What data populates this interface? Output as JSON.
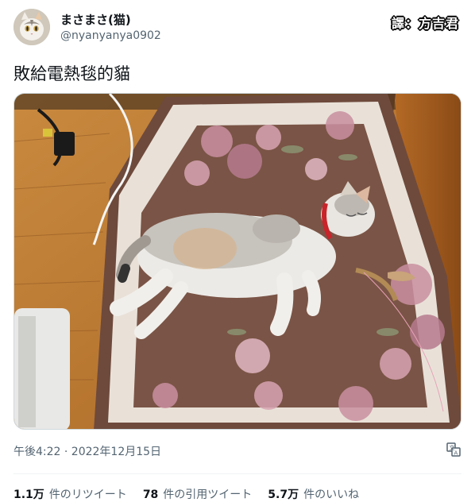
{
  "author": {
    "display_name": "まさまさ(猫)",
    "handle": "@nyanyanya0902",
    "avatar_icon": "cat-avatar-icon"
  },
  "translator_badge": "譯：方吉君",
  "tweet": {
    "text": "敗給電熱毯的貓",
    "media_icon": "sleeping-cat-photo"
  },
  "meta": {
    "timestamp": "午後4:22 · 2022年12月15日",
    "translate_icon": "translate-icon"
  },
  "stats": [
    {
      "count": "1.1万",
      "label": "件のリツイート"
    },
    {
      "count": "78",
      "label": "件の引用ツイート"
    },
    {
      "count": "5.7万",
      "label": "件のいいね"
    }
  ],
  "colors": {
    "text_primary": "#0f1419",
    "text_secondary": "#536471",
    "divider": "#eff3f4"
  }
}
